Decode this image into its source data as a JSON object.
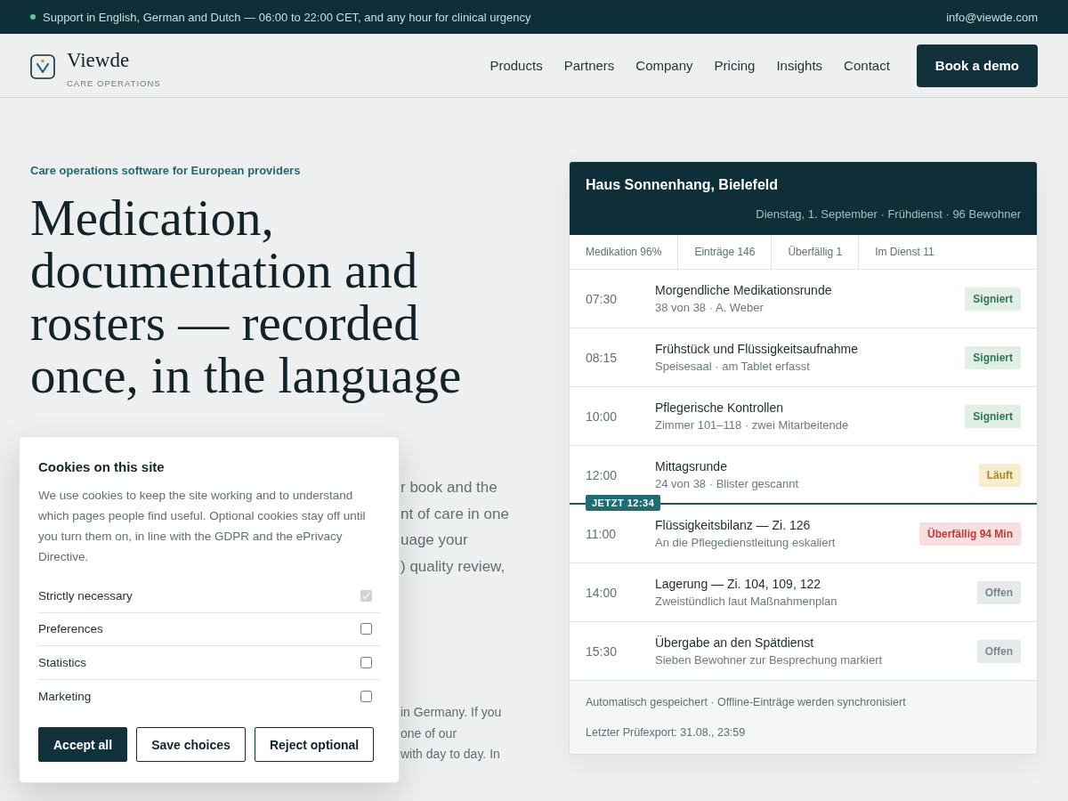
{
  "top_bar": {
    "support": "Support in English, German and Dutch — 06:00 to 22:00 CET, and any hour for clinical urgency",
    "email": "info@viewde.com"
  },
  "header": {
    "brand": "Viewde",
    "tagline": "CARE OPERATIONS",
    "nav": [
      "Products",
      "Partners",
      "Company",
      "Pricing",
      "Insights",
      "Contact"
    ],
    "cta": "Book a demo"
  },
  "hero": {
    "eyebrow": "Care operations software for European providers",
    "heading": "Medication, documentation and rosters — recorded once, in the language",
    "lead_fragments": [
      "r book and the",
      "nt of care in one",
      "uage your",
      ") quality review,"
    ],
    "note_fragments": [
      "in Germany. If you",
      "one of our",
      "with day to day. In"
    ]
  },
  "panel": {
    "title": "Haus Sonnenhang, Bielefeld",
    "subtitle": "Dienstag, 1. September · Frühdienst · 96 Bewohner",
    "stats": [
      "Medikation 96%",
      "Einträge 146",
      "Überfällig 1",
      "Im Dienst 11"
    ],
    "rows": [
      {
        "time": "07:30",
        "title": "Morgendliche Medikationsrunde",
        "detail": "38 von 38 · A. Weber",
        "kind": "signed",
        "badge": "Signiert"
      },
      {
        "time": "08:15",
        "title": "Frühstück und Flüssigkeitsaufnahme",
        "detail": "Speisesaal · am Tablet erfasst",
        "kind": "signed",
        "badge": "Signiert"
      },
      {
        "time": "10:00",
        "title": "Pflegerische Kontrollen",
        "detail": "Zimmer 101–118 · zwei Mitarbeitende",
        "kind": "signed",
        "badge": "Signiert"
      },
      {
        "time": "12:00",
        "title": "Mittagsrunde",
        "detail": "24 von 38 · Blister gescannt",
        "kind": "running",
        "badge": "Läuft"
      },
      {
        "time": "11:00",
        "title": "Flüssigkeitsbilanz — Zi. 126",
        "detail": "An die Pflegedienstleitung eskaliert",
        "kind": "overdue",
        "badge": "Überfällig 94 Min",
        "now_marker": "JETZT 12:34"
      },
      {
        "time": "14:00",
        "title": "Lagerung — Zi. 104, 109, 122",
        "detail": "Zweistündlich laut Maßnahmenplan",
        "kind": "open",
        "badge": "Offen"
      },
      {
        "time": "15:30",
        "title": "Übergabe an den Spätdienst",
        "detail": "Sieben Bewohner zur Besprechung markiert",
        "kind": "open",
        "badge": "Offen"
      }
    ],
    "footer": [
      "Automatisch gespeichert · Offline-Einträge werden synchronisiert",
      "Letzter Prüfexport: 31.08., 23:59"
    ]
  },
  "cookie_dialog": {
    "title": "Cookies on this site",
    "text": "We use cookies to keep the site working and to understand which pages people find useful. Optional cookies stay off until you turn them on, in line with the GDPR and the ePrivacy Directive.",
    "options": [
      {
        "label": "Strictly necessary",
        "checked": true,
        "disabled": true
      },
      {
        "label": "Preferences",
        "checked": false,
        "disabled": false
      },
      {
        "label": "Statistics",
        "checked": false,
        "disabled": false
      },
      {
        "label": "Marketing",
        "checked": false,
        "disabled": false
      }
    ],
    "buttons": [
      {
        "label": "Accept all",
        "kind": "primary"
      },
      {
        "label": "Save choices",
        "kind": "secondary"
      },
      {
        "label": "Reject optional",
        "kind": "secondary"
      }
    ]
  }
}
